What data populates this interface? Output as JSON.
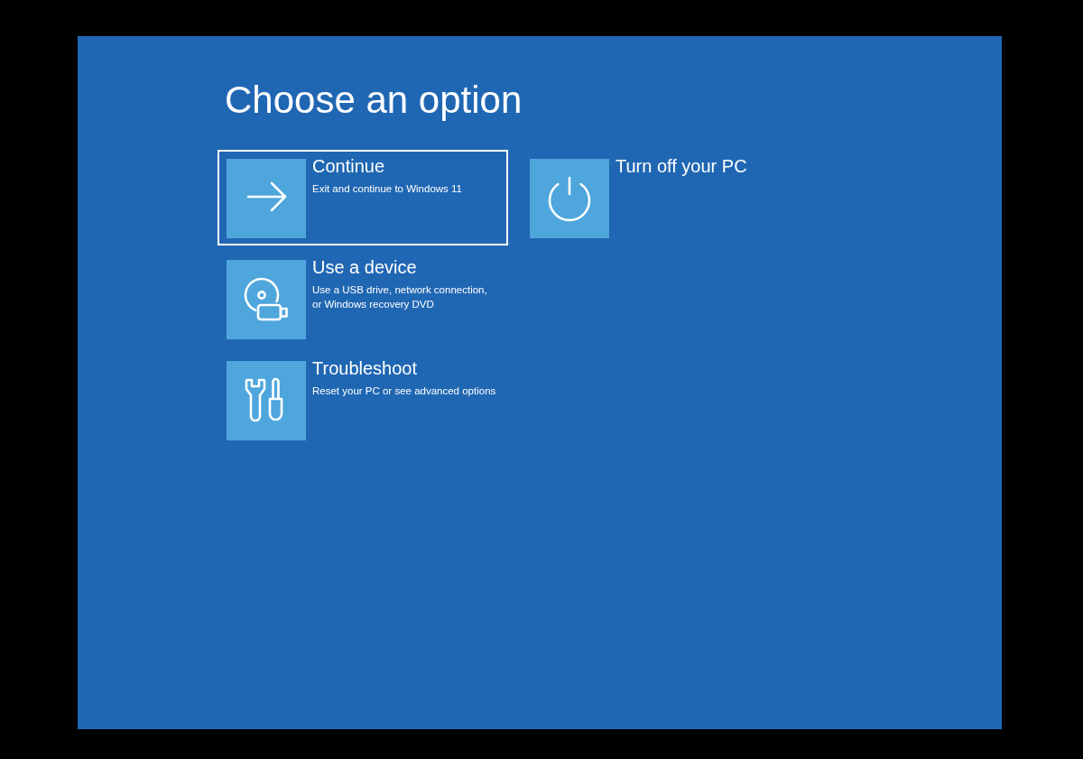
{
  "title": "Choose an option",
  "options": [
    {
      "kind": "continue",
      "title": "Continue",
      "description": "Exit and continue to Windows 11",
      "selected": true
    },
    {
      "kind": "device",
      "title": "Use a device",
      "description": "Use a USB drive, network connection,\nor Windows recovery DVD",
      "selected": false
    },
    {
      "kind": "troubleshoot",
      "title": "Troubleshoot",
      "description": "Reset your PC or see advanced options",
      "selected": false
    },
    {
      "kind": "shutdown",
      "title": "Turn off your PC",
      "selected": false
    }
  ]
}
